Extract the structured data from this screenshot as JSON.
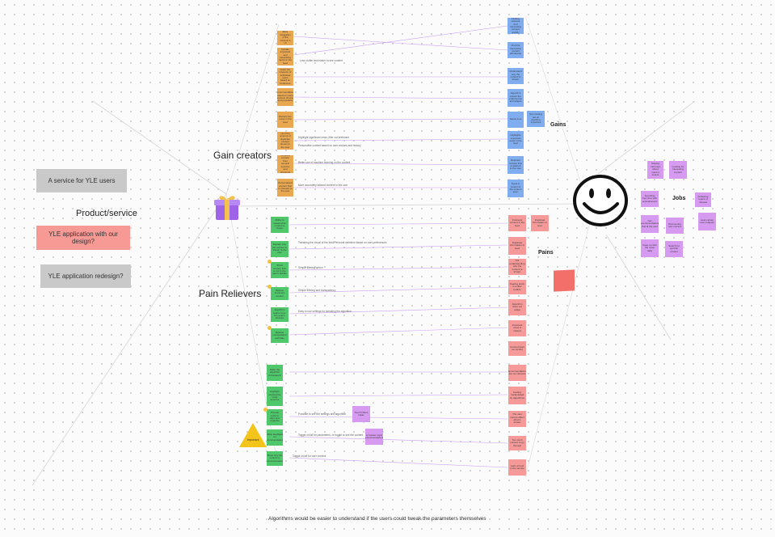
{
  "left": {
    "service_box": "A service for YLE users",
    "product_service": "Product/service",
    "application_design": "YLE application with our design?",
    "application_redesign": "YLE application redesign?"
  },
  "headings": {
    "gain_creators": "Gain creators",
    "pain_relievers": "Pain Relievers",
    "gains": "Gains",
    "pains": "Pains",
    "jobs": "Jobs"
  },
  "footer": "Algorithms would be easier to understand if the users could tweak the parameters themselves",
  "important_label": "Important",
  "colors": {
    "gain_creator": "#e9a750",
    "gain": "#80adf0",
    "pain_reliever": "#4fc86b",
    "pain": "#f59a99",
    "job": "#d69bf0",
    "triangle": "#f3c51a",
    "gray_box": "#c9c9c9",
    "red_box": "#f79a96"
  },
  "icons": {
    "gift": "gift-icon",
    "face": "smiley-face-icon"
  },
  "gain_creators": [
    "Easy navigation of the content in UI",
    "Include important and interesting topics in the feed",
    "Learn the interests of individual users based on behaviour",
    "Recommendations based on users' previous choices and popularity",
    "Reduce the noise in the feed",
    "Limit the amount of duplicate content shown to the user",
    "Combine content from several sources and channels",
    "Personalised content that is relevant to the user"
  ],
  "gains": [
    "Finding relevant and interesting content quickly",
    "Find the interesting content effortlessly",
    "Understand why the content is shown",
    "Algorithm knows the preferences and adapts",
    "Saves time",
    "Not missing out on anything important",
    "Highlights important news in the feed",
    "Relevant content that is tailored to the user",
    "Feels in control of the content seen"
  ],
  "pain_relievers": [
    "Ability to tweak what content is shown",
    "Explain why the content is shown to the user",
    "Show content that is not in the user's bubble",
    "Reduce irrelevant content",
    "Algorithm learns from the user's choices",
    "Reduce manipulation and bias",
    "Make the algorithm transparent",
    "Highlight trustworthy news sources",
    "Provide tools to filter and organise",
    "Allow feedback on recommendations",
    "Show why the content is recommended"
  ],
  "pains": [
    "Irrelevant content in the feed",
    "Duplicate information in feed",
    "Not understanding why the content is shown",
    "Feeling stuck in a filter bubble",
    "Algorithm does not adapt",
    "Important news is missed",
    "Content feels too similar",
    "Recommendations are not relevant",
    "Feeling manipulated by algorithms",
    "The user cannot affect what is shown",
    "Too much content to go through",
    "Lack of trust in the service"
  ],
  "pain_extra": [
    "Duplicate information in feed"
  ],
  "jobs": [
    "Staying informed about current events",
    "Looking for interesting content",
    "Spending free time with entertainment",
    "Following topics of interest",
    "Get recommendations that fit the user",
    "Discovering new content",
    "Learn about new subjects",
    "Keep up with the news daily",
    "Search for specific content",
    "Relaxing and being entertained",
    "Share content with others"
  ],
  "connector_notes": [
    "Less clutter and easier to see content",
    "Highlight significant news, filter out irrelevant",
    "Personalise content based on user choices and history",
    "Better use of machine learning on the content",
    "More accurately tailored content to the user",
    "Tweaking the visual of the feed/Personal selection based on user preferences",
    "Simple filtering option",
    "Simple filtering and transparency",
    "Easy to use settings for tweaking the algorithm",
    "Possible to see the settings and algorithm",
    "Toggle on/off for parameters, or toggle to see the content",
    "Toggle on/off for user content"
  ],
  "side_notes": [
    "Touch Filters Ideas",
    "A Custom topic recommendations"
  ]
}
